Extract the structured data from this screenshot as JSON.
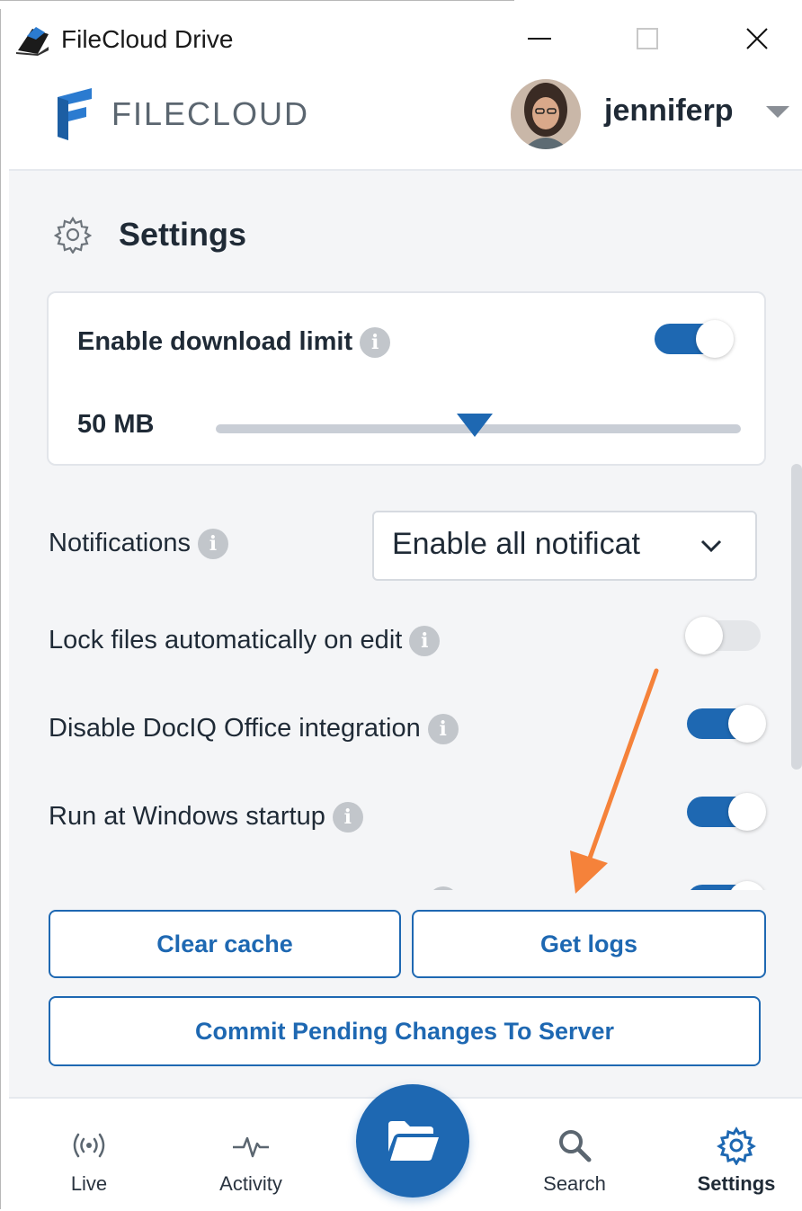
{
  "window": {
    "title": "FileCloud Drive"
  },
  "header": {
    "brand": "FILECLOUD",
    "username": "jenniferp"
  },
  "settings": {
    "title": "Settings",
    "download_limit": {
      "label": "Enable download limit",
      "enabled": true,
      "value_text": "50 MB",
      "slider_fraction": 0.5
    },
    "notifications": {
      "label": "Notifications",
      "selected": "Enable all notificat"
    },
    "toggles": [
      {
        "label": "Lock files automatically on edit",
        "enabled": false
      },
      {
        "label": "Disable DocIQ Office integration",
        "enabled": true
      },
      {
        "label": "Run at Windows startup",
        "enabled": true
      }
    ]
  },
  "actions": {
    "clear_cache": "Clear cache",
    "get_logs": "Get logs",
    "commit": "Commit Pending Changes To Server"
  },
  "nav": {
    "items": [
      {
        "label": "Live",
        "icon": "live-icon"
      },
      {
        "label": "Activity",
        "icon": "activity-icon"
      },
      {
        "label": "",
        "icon": "folder-icon"
      },
      {
        "label": "Search",
        "icon": "search-icon"
      },
      {
        "label": "Settings",
        "icon": "settings-icon",
        "active": true
      }
    ]
  },
  "colors": {
    "accent": "#1e68b2",
    "annotation_arrow": "#f5823a",
    "background": "#f4f5f7",
    "text": "#1f2a36"
  }
}
